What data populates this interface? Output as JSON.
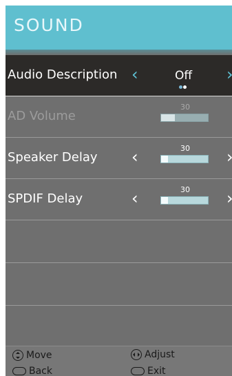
{
  "menu": {
    "title": "SOUND"
  },
  "items": [
    {
      "label": "Audio Description",
      "value": "Off",
      "options_count": 2,
      "selected_option": 2
    },
    {
      "label": "AD Volume",
      "value": "30",
      "level": 0.3,
      "enabled": false
    },
    {
      "label": "Speaker Delay",
      "value": "30",
      "level": 0.15,
      "enabled": true
    },
    {
      "label": "SPDIF Delay",
      "value": "30",
      "level": 0.15,
      "enabled": true
    }
  ],
  "arrows": {
    "left": "‹",
    "right": "›"
  },
  "footer": {
    "move": "Move",
    "adjust": "Adjust",
    "back": "Back",
    "exit": "Exit",
    "icons": [
      "up-down-icon",
      "left-right-icon",
      "back-key-icon",
      "exit-key-icon"
    ]
  },
  "colors": {
    "accent": "#5fbfcf",
    "selected_row": "#2c2a28",
    "background": "#6f6f6f"
  }
}
